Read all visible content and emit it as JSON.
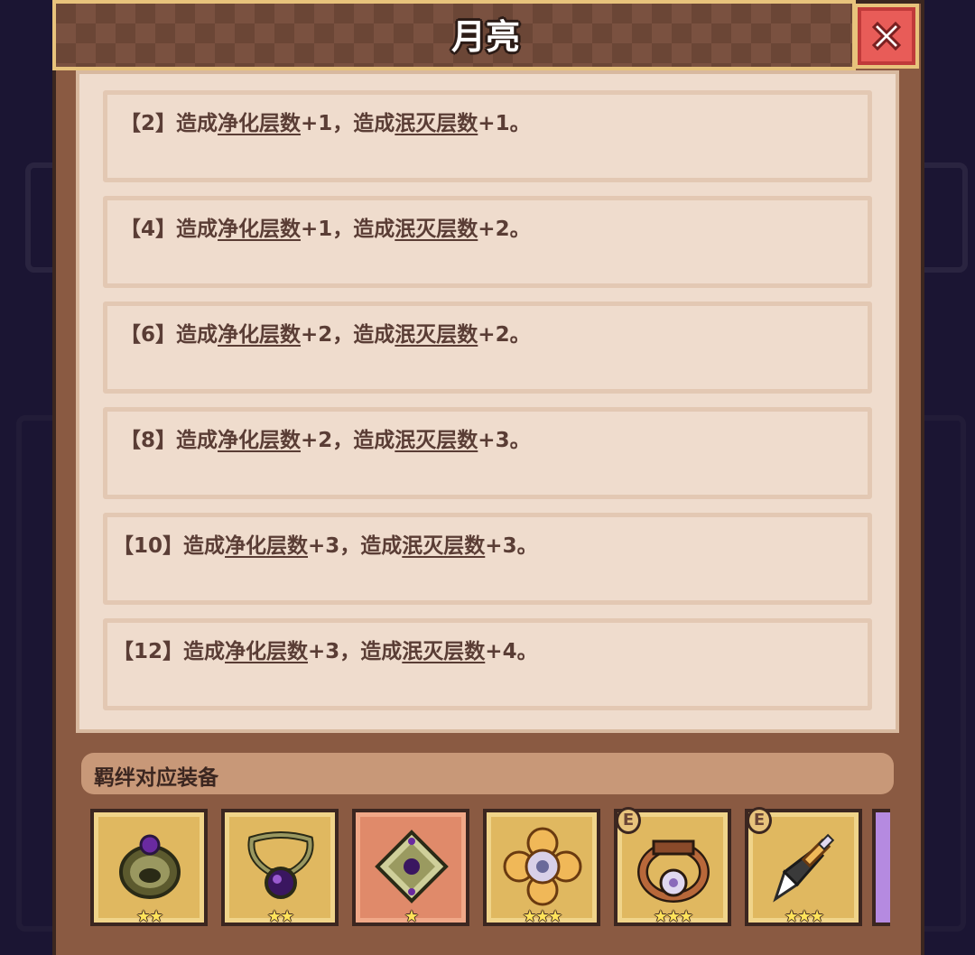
{
  "dialog": {
    "title": "月亮"
  },
  "tiers": [
    {
      "count": "【2】",
      "prefix": "造成",
      "kw1": "净化层数",
      "v1": "+1",
      "mid": "，造成",
      "kw2": "泯灭层数",
      "v2": "+1。"
    },
    {
      "count": "【4】",
      "prefix": "造成",
      "kw1": "净化层数",
      "v1": "+1",
      "mid": "，造成",
      "kw2": "泯灭层数",
      "v2": "+2。"
    },
    {
      "count": "【6】",
      "prefix": "造成",
      "kw1": "净化层数",
      "v1": "+2",
      "mid": "，造成",
      "kw2": "泯灭层数",
      "v2": "+2。"
    },
    {
      "count": "【8】",
      "prefix": "造成",
      "kw1": "净化层数",
      "v1": "+2",
      "mid": "，造成",
      "kw2": "泯灭层数",
      "v2": "+3。"
    },
    {
      "count": "【10】",
      "prefix": "造成",
      "kw1": "净化层数",
      "v1": "+3",
      "mid": "，造成",
      "kw2": "泯灭层数",
      "v2": "+3。"
    },
    {
      "count": "【12】",
      "prefix": "造成",
      "kw1": "净化层数",
      "v1": "+3",
      "mid": "，造成",
      "kw2": "泯灭层数",
      "v2": "+4。"
    }
  ],
  "equipment": {
    "label": "羁绊对应装备",
    "items": [
      {
        "icon": "bracelet-icon",
        "stars": "★★",
        "star_count": 2,
        "badge": "",
        "selected": false
      },
      {
        "icon": "necklace-icon",
        "stars": "★★",
        "star_count": 2,
        "badge": "",
        "selected": false
      },
      {
        "icon": "gem-icon",
        "stars": "★",
        "star_count": 1,
        "badge": "",
        "selected": true
      },
      {
        "icon": "flower-brooch-icon",
        "stars": "★★★",
        "star_count": 3,
        "badge": "",
        "selected": false
      },
      {
        "icon": "ring-icon",
        "stars": "★★★",
        "star_count": 3,
        "badge": "E",
        "selected": false
      },
      {
        "icon": "dagger-icon",
        "stars": "★★★",
        "star_count": 3,
        "badge": "E",
        "selected": false
      }
    ]
  },
  "colors": {
    "panel": "#8a5a42",
    "list_bg": "#efdccd",
    "text": "#5a3d35",
    "slot_gold": "#e0b860",
    "slot_selected": "#e08a6a",
    "close_red": "#e85c58"
  }
}
